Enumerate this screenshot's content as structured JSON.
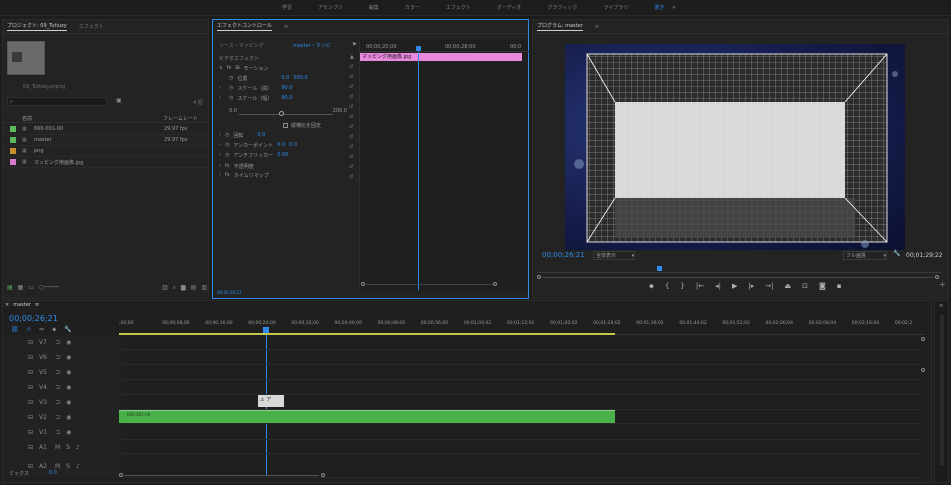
{
  "workspace_tabs": [
    "学習",
    "アセンブリ",
    "編集",
    "カラー",
    "エフェクト",
    "オーディオ",
    "グラフィック",
    "ライブラリ",
    "書き"
  ],
  "workspace_active_index": 8,
  "project_panel": {
    "tabs": [
      "プロジェクト: 09_Tutiuzy",
      "エフェクト"
    ],
    "project_file": "09_Tutiuzy.prproj",
    "item_count": "4 個",
    "columns": {
      "name": "名前",
      "fps": "フレームレート"
    },
    "items": [
      {
        "name": "666-001-00",
        "fps": "29.97 fps",
        "color": "#5cb85c"
      },
      {
        "name": "master",
        "fps": "29.97 fps",
        "color": "#5cb85c"
      },
      {
        "name": "png",
        "fps": "",
        "color": "#c89030"
      },
      {
        "name": "マッピング用画像.jpg",
        "fps": "",
        "color": "#d77ac9"
      }
    ]
  },
  "effect_controls": {
    "tabs": [
      "エフェクトコントロール",
      "≡"
    ],
    "source_label": "ソース・マッピング",
    "clip_label": "master・マッピ",
    "video_effects": "ビデオエフェクト",
    "timecodes": [
      "00;00;20;00",
      "00;00;28;00",
      "00;0"
    ],
    "clip_name": "マッピング用画像.jpg",
    "motion": "モーション",
    "properties": [
      {
        "name": "位置",
        "value1": "0.0",
        "value2": "000.0"
      },
      {
        "name": "スケール（高）",
        "value1": "90.0",
        "value2": ""
      },
      {
        "name": "スケール（幅）",
        "value1": "90.0",
        "value2": ""
      }
    ],
    "slider_min": "0.0",
    "slider_max": "200.0",
    "uniform_scale": "縦横比を固定",
    "rotation": {
      "name": "回転",
      "value": "0.0"
    },
    "anchor": {
      "name": "アンカーポイント",
      "value1": "0.0",
      "value2": "0.0"
    },
    "flicker": {
      "name": "アンチフリッカー",
      "value": "0.00"
    },
    "opacity": "不透明度",
    "time_remap": "タイムリマップ",
    "bottom_time": "00;00;26;21"
  },
  "program_monitor": {
    "title": "プログラム: master",
    "current_time": "00;00;26;21",
    "fit": "全体表示",
    "quality": "フル画質",
    "duration": "00;01;29;22"
  },
  "timeline": {
    "title": "master",
    "current_time": "00;00;26;21",
    "ruler": [
      ";00;00",
      "00;00;08;00",
      "00;00;16;00",
      "00;00;24;00",
      "00;00;32;00",
      "00;00;40;00",
      "00;00;48;00",
      "00;00;56;00",
      "00;01;04;02",
      "00;01;12;02",
      "00;01;20;02",
      "00;01;28;02",
      "00;01;36;02",
      "00;01;44;02",
      "00;01;52;02",
      "00;02;00;04",
      "00;02;08;04",
      "00;02;16;04",
      "00;02;2"
    ],
    "video_tracks": [
      "V7",
      "V6",
      "V5",
      "V4",
      "V3",
      "V2",
      "V1"
    ],
    "audio_tracks": [
      "A1",
      "A2"
    ],
    "mix_label": "ミックス",
    "mix_value": "0.0",
    "clip_v1": "666-001-00",
    "clip_v2": "ア",
    "clip_color": "#4ab04a"
  }
}
